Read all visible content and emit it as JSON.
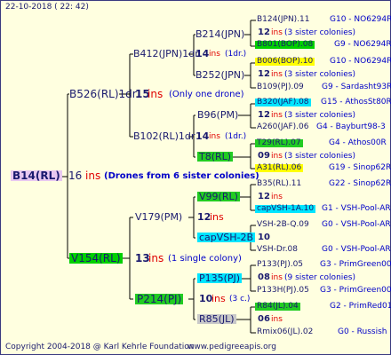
{
  "header": {
    "date": "22-10-2018 ( 22: 42)"
  },
  "footer": {
    "copyright": "Copyright 2004-2018 @ Karl Kehrle Foundation",
    "site": "www.pedigreeapis.org"
  },
  "root": {
    "name": "B14(RL)",
    "ins": "16",
    "ins_word": "ins",
    "note": "(Drones from 6 sister colonies)"
  },
  "sire": {
    "name": "B526(RL)1dr",
    "ins": "15",
    "ins_word": "ins",
    "note": "(Only one drone)"
  },
  "sire_sire": {
    "name": "B412(JPN)1dr",
    "ins": "14",
    "ins_word": "ins",
    "note": "(1dr.)"
  },
  "sire_sire_sire": {
    "name": "B214(JPN)"
  },
  "sire_sire_dam": {
    "name": "B252(JPN)"
  },
  "sire_dam": {
    "name": "B102(RL)1dr",
    "ins": "14",
    "ins_word": "ins",
    "note": "(1dr.)"
  },
  "sire_dam_sire": {
    "name": "B96(PM)"
  },
  "sire_dam_dam": {
    "name": "T8(RL)"
  },
  "dam": {
    "name": "V154(RL)",
    "ins": "13",
    "ins_word": "ins",
    "note": "(1 single colony)"
  },
  "dam_sire": {
    "name": "V179(PM)",
    "ins": "12",
    "ins_word": "ins"
  },
  "dam_sire_sire": {
    "name": "V99(RL)"
  },
  "dam_sire_dam": {
    "name": "capVSH-2B"
  },
  "dam_dam": {
    "name": "P214(PJ)",
    "ins": "10",
    "ins_word": "ins",
    "note": "(3 c.)"
  },
  "dam_dam_sire": {
    "name": "P135(PJ)"
  },
  "dam_dam_dam": {
    "name": "R85(JL)"
  },
  "gen5": [
    {
      "name": "B124(JPN).11",
      "code": "G10 - NO6294R"
    },
    {
      "count": "12",
      "ins_word": "ins",
      "note": "(3 sister colonies)"
    },
    {
      "name": "B801(BOP).08",
      "code": "G9 - NO6294R"
    },
    {
      "name": "B006(BOP).10",
      "code": "G10 - NO6294R"
    },
    {
      "count": "12",
      "ins_word": "ins",
      "note": "(3 sister colonies)"
    },
    {
      "name": "B109(PJ).09",
      "code": "G9 - Sardasht93R"
    },
    {
      "name": "B320(JAF).08",
      "code": "G15 - AthosSt80R"
    },
    {
      "count": "12",
      "ins_word": "ins",
      "note": "(3 sister colonies)"
    },
    {
      "name": "A260(JAF).06",
      "code": "G4 - Bayburt98-3"
    },
    {
      "name": "T29(RL).07",
      "code": "G4 - Athos00R"
    },
    {
      "count": "09",
      "ins_word": "ins",
      "note": "(3 sister colonies)"
    },
    {
      "name": "A31(RL).06",
      "code": "G19 - Sinop62R"
    },
    {
      "name": "B35(RL).11",
      "code": "G22 - Sinop62R"
    },
    {
      "count": "12",
      "ins_word": "ins"
    },
    {
      "name": "capVSH-1A.10",
      "code": "G1 - VSH-Pool-AR"
    },
    {
      "name": "VSH-2B-Q.09",
      "code": "G0 - VSH-Pool-AR"
    },
    {
      "count": "10"
    },
    {
      "name": "VSH-Dr.08",
      "code": "G0 - VSH-Pool-AR"
    },
    {
      "name": "P133(PJ).05",
      "code": "G3 - PrimGreen00"
    },
    {
      "count": "08",
      "ins_word": "ins",
      "note": "(9 sister colonies)"
    },
    {
      "name": "P133H(PJ).05",
      "code": "G3 - PrimGreen00"
    },
    {
      "name": "R84(JL).04",
      "code": "G2 - PrimRed01"
    },
    {
      "count": "06",
      "ins_word": "ins"
    },
    {
      "name": "Rmix06(JL).02",
      "code": "G0 - Russish"
    }
  ]
}
